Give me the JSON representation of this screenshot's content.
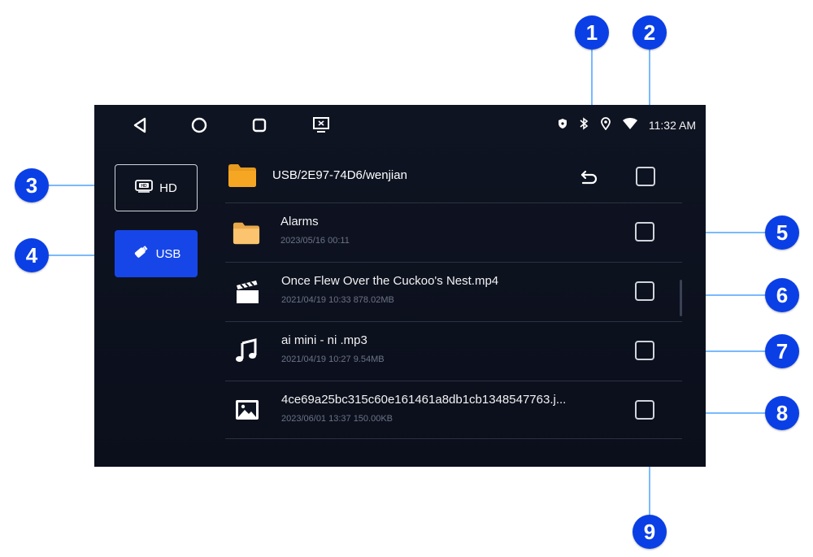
{
  "statusbar": {
    "nav_icons": [
      "back-triangle-icon",
      "home-circle-icon",
      "recents-square-icon",
      "screen-cast-icon"
    ],
    "status_icons": [
      "shield-icon",
      "bluetooth-icon",
      "location-icon",
      "wifi-icon"
    ],
    "time": "11:32 AM"
  },
  "sidebar": {
    "hd_label": "HD",
    "usb_label": "USB"
  },
  "header": {
    "path": "USB/2E97-74D6/wenjian"
  },
  "files": [
    {
      "name": "Alarms",
      "meta": "2023/05/16 00:11",
      "icon": "folder-icon"
    },
    {
      "name": "Once Flew Over the Cuckoo's Nest.mp4",
      "meta": "2021/04/19 10:33  878.02MB",
      "icon": "video-clapper-icon"
    },
    {
      "name": "ai mini - ni .mp3",
      "meta": "2021/04/19 10:27  9.54MB",
      "icon": "music-note-icon"
    },
    {
      "name": "4ce69a25bc315c60e161461a8db1cb1348547763.j...",
      "meta": "2023/06/01 13:37  150.00KB",
      "icon": "image-icon"
    }
  ],
  "callouts": [
    "1",
    "2",
    "3",
    "4",
    "5",
    "6",
    "7",
    "8",
    "9"
  ],
  "colors": {
    "screen_bg": "#0f1422",
    "accent_blue": "#1746e8",
    "callout_blue": "#0a3fe6",
    "folder_orange": "#f5a623"
  }
}
